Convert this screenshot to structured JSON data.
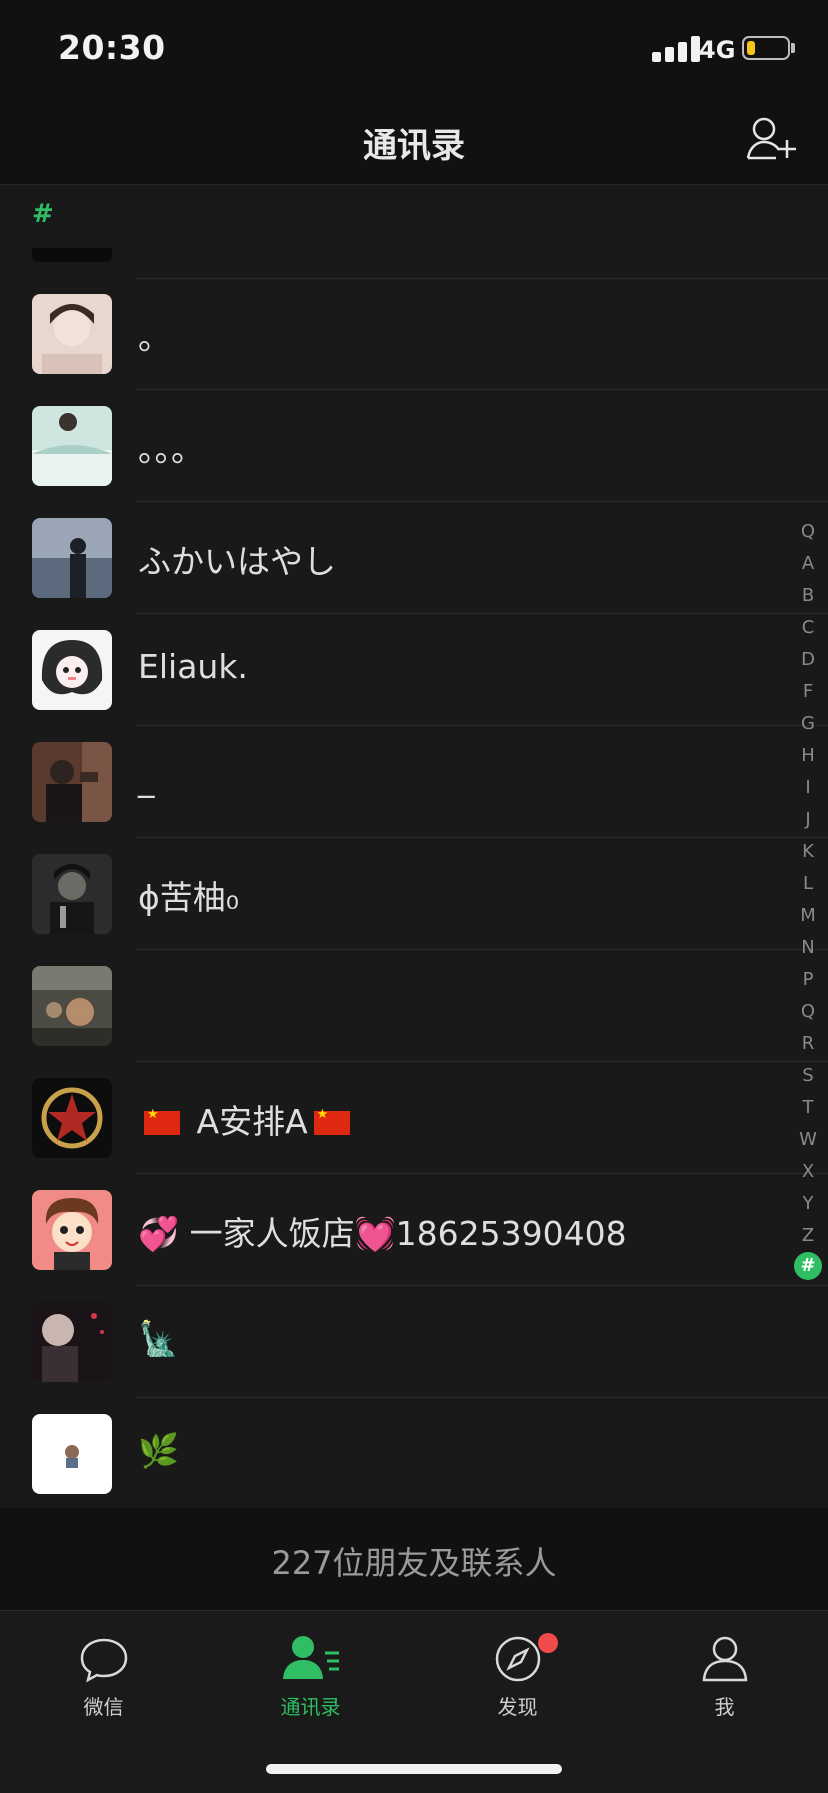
{
  "status": {
    "time": "20:30",
    "network": "4G",
    "battery_percent": 20
  },
  "header": {
    "title": "通讯录",
    "add_icon": "add-contact-icon"
  },
  "section": {
    "letter": "#"
  },
  "contacts": [
    {
      "name": "。"
    },
    {
      "name": "。。。"
    },
    {
      "name": "ふかいはやし"
    },
    {
      "name": "Eliauk."
    },
    {
      "name": "_"
    },
    {
      "name": "ɸ苦柚₀"
    },
    {
      "name": ""
    },
    {
      "name_prefix": "",
      "name_main": "A安排A",
      "name_suffix": ""
    },
    {
      "name": "💞 一家人饭店💓18625390408"
    },
    {
      "name": "🗽"
    },
    {
      "name": "🌿"
    }
  ],
  "index": [
    "Q",
    "A",
    "B",
    "C",
    "D",
    "F",
    "G",
    "H",
    "I",
    "J",
    "K",
    "L",
    "M",
    "N",
    "P",
    "Q",
    "R",
    "S",
    "T",
    "W",
    "X",
    "Y",
    "Z"
  ],
  "index_active": "#",
  "footer": {
    "count_text": "227位朋友及联系人"
  },
  "tabs": [
    {
      "label": "微信",
      "icon": "chat-bubble-icon"
    },
    {
      "label": "通讯录",
      "icon": "contacts-icon"
    },
    {
      "label": "发现",
      "icon": "compass-icon"
    },
    {
      "label": "我",
      "icon": "person-icon"
    }
  ],
  "colors": {
    "accent": "#2fbe63",
    "badge": "#f04a4a",
    "background": "#191919"
  }
}
